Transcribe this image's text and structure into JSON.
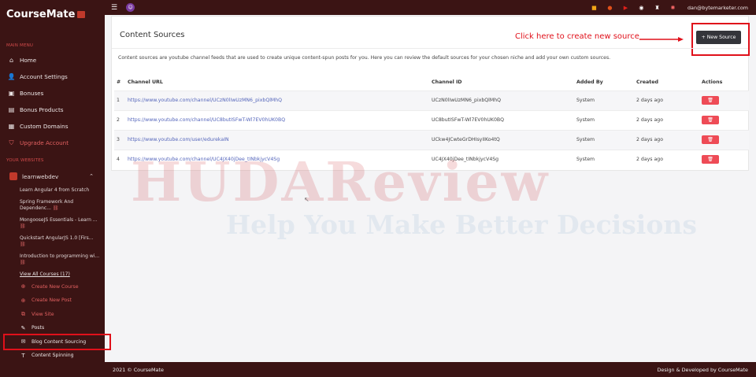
{
  "brand": {
    "name": "CourseMate"
  },
  "sidebar": {
    "main_menu_label": "MAIN MENU",
    "items": [
      {
        "label": "Home",
        "icon": "home-icon"
      },
      {
        "label": "Account Settings",
        "icon": "user-icon"
      },
      {
        "label": "Bonuses",
        "icon": "briefcase-icon"
      },
      {
        "label": "Bonus Products",
        "icon": "box-icon"
      },
      {
        "label": "Custom Domains",
        "icon": "building-icon"
      },
      {
        "label": "Upgrade Account",
        "icon": "shield-icon"
      }
    ],
    "websites_label": "YOUR WEBSITES",
    "site": {
      "name": "learnwebdev"
    },
    "courses": [
      "Learn Angular 4 from Scratch",
      "Spring Framework And Dependenc...",
      "MongooseJS Essentials - Learn ...",
      "Quickstart AngularJS 1.0 [Firs...",
      "Introduction to programming wi..."
    ],
    "view_all": "View All Courses (17)",
    "actions": [
      {
        "label": "Create New Course",
        "icon": "plus-circle-icon"
      },
      {
        "label": "Create New Post",
        "icon": "plus-circle-icon"
      },
      {
        "label": "View Site",
        "icon": "external-link-icon"
      },
      {
        "label": "Posts",
        "icon": "edit-icon"
      },
      {
        "label": "Blog Content Sourcing",
        "icon": "envelope-icon"
      },
      {
        "label": "Content Spinning",
        "icon": "text-icon"
      }
    ]
  },
  "topbar": {
    "email": "dan@bytemarketer.com"
  },
  "page": {
    "title": "Content Sources",
    "callout": "Click here to create new source",
    "new_button": "+ New Source",
    "description": "Content sources are youtube channel feeds that are used to create unique content-spun posts for you. Here you can review the default sources for your chosen niche and add your own custom sources."
  },
  "table": {
    "headers": [
      "#",
      "Channel URL",
      "Channel ID",
      "Added By",
      "Created",
      "Actions"
    ],
    "rows": [
      {
        "num": "1",
        "url": "https://www.youtube.com/channel/UCzN0lIwUzMN6_pixbQlMhQ",
        "id": "UCzN0lIwUzMN6_pixbQlMhQ",
        "by": "System",
        "created": "2 days ago"
      },
      {
        "num": "2",
        "url": "https://www.youtube.com/channel/UC8butISFwT-Wl7EV0hUK0BQ",
        "id": "UC8butISFwT-Wl7EV0hUK0BQ",
        "by": "System",
        "created": "2 days ago"
      },
      {
        "num": "3",
        "url": "https://www.youtube.com/user/edurekaIN",
        "id": "UCkw4JCwteGrDHIsyIIKo4tQ",
        "by": "System",
        "created": "2 days ago"
      },
      {
        "num": "4",
        "url": "https://www.youtube.com/channel/UC4JX40jDee_tINbkjycV4Sg",
        "id": "UC4JX40jDee_tINbkjycV4Sg",
        "by": "System",
        "created": "2 days ago"
      }
    ]
  },
  "watermark": {
    "line1": "HUDAReview",
    "line2": "Help You Make Better Decisions"
  },
  "footer": {
    "left": "2021 © CourseMate",
    "right": "Design & Developed by CourseMate"
  },
  "colors": {
    "sidebar_bg": "#3b1414",
    "accent_red": "#e0101a",
    "delete_button": "#ee4b56",
    "link": "#5566bb"
  }
}
